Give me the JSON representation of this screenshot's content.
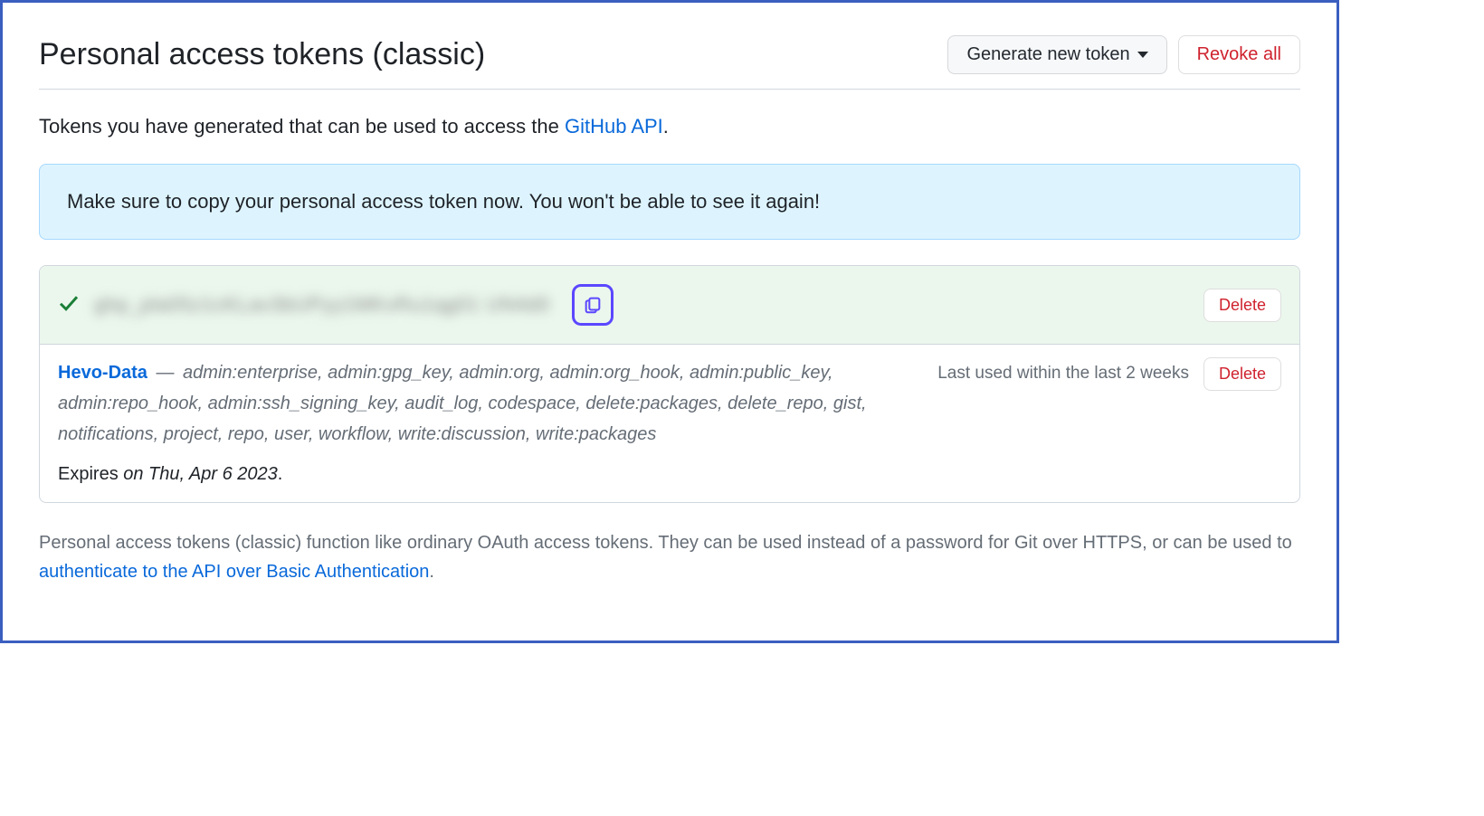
{
  "header": {
    "title": "Personal access tokens (classic)",
    "generate_label": "Generate new token",
    "revoke_label": "Revoke all"
  },
  "intro": {
    "prefix": "Tokens you have generated that can be used to access the ",
    "link": "GitHub API",
    "suffix": "."
  },
  "flash": "Make sure to copy your personal access token now. You won't be able to see it again!",
  "tokens": {
    "new": {
      "masked": "ghp_pla05z1cKLav3bUPyy1MKvRu1qg01 UN4d0",
      "delete_label": "Delete"
    },
    "existing": {
      "name": "Hevo-Data",
      "scopes": "admin:enterprise, admin:gpg_key, admin:org, admin:org_hook, admin:public_key, admin:repo_hook, admin:ssh_signing_key, audit_log, codespace, delete:packages, delete_repo, gist, notifications, project, repo, user, workflow, write:discussion, write:packages",
      "last_used": "Last used within the last 2 weeks",
      "expires_prefix": "Expires ",
      "expires_when": "on Thu, Apr 6 2023",
      "expires_suffix": ".",
      "delete_label": "Delete"
    }
  },
  "footer": {
    "part1": "Personal access tokens (classic) function like ordinary OAuth access tokens. They can be used instead of a password for Git over HTTPS, or can be used to ",
    "link": "authenticate to the API over Basic Authentication",
    "part2": "."
  }
}
